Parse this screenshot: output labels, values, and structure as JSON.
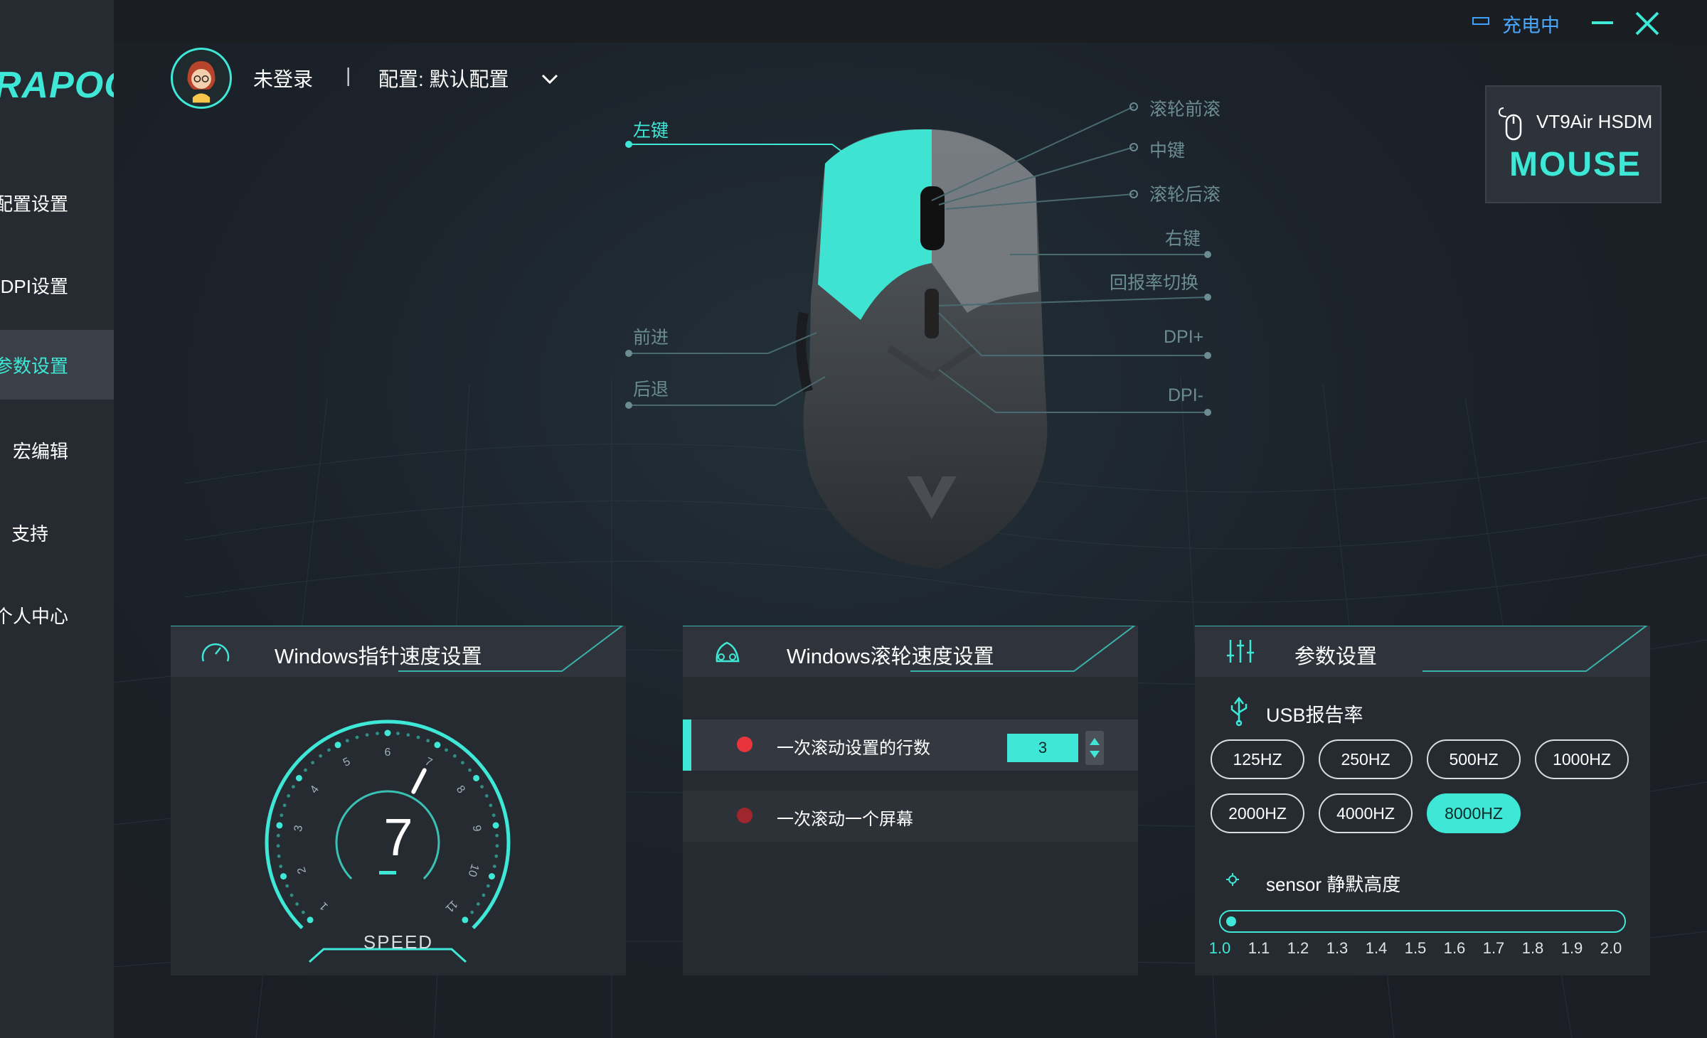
{
  "sidebar": {
    "logo": "RAPOO",
    "items": [
      {
        "label": "配置设置"
      },
      {
        "label": "DPI设置"
      },
      {
        "label": "参数设置"
      },
      {
        "label": "宏编辑"
      },
      {
        "label": "支持"
      },
      {
        "label": "个人中心"
      }
    ]
  },
  "window": {
    "charging_label": "充电中"
  },
  "header": {
    "login_status": "未登录",
    "separator": "|",
    "config_label": "配置: 默认配置"
  },
  "device": {
    "name": "VT9Air HSDM",
    "type": "MOUSE"
  },
  "mouse_buttons": {
    "left": "左键",
    "forward": "前进",
    "back": "后退",
    "wheel_forward": "滚轮前滚",
    "middle": "中键",
    "wheel_back": "滚轮后滚",
    "right": "右键",
    "report_rate_switch": "回报率切换",
    "dpi_plus": "DPI+",
    "dpi_minus": "DPI-"
  },
  "pointer_panel": {
    "title": "Windows指针速度设置",
    "speed_value": "7",
    "speed_label": "SPEED",
    "scale": [
      "1",
      "2",
      "3",
      "4",
      "5",
      "6",
      "7",
      "8",
      "9",
      "10",
      "11"
    ]
  },
  "scroll_panel": {
    "title": "Windows滚轮速度设置",
    "options": [
      {
        "label": "一次滚动设置的行数",
        "value": "3",
        "selected": true
      },
      {
        "label": "一次滚动一个屏幕",
        "selected": false
      }
    ]
  },
  "params_panel": {
    "title": "参数设置",
    "usb_label": "USB报告率",
    "rates": [
      "125HZ",
      "250HZ",
      "500HZ",
      "1000HZ",
      "2000HZ",
      "4000HZ",
      "8000HZ"
    ],
    "selected_rate": "8000HZ",
    "sensor_label": "sensor 静默高度",
    "lod_ticks": [
      "1.0",
      "1.1",
      "1.2",
      "1.3",
      "1.4",
      "1.5",
      "1.6",
      "1.7",
      "1.8",
      "1.9",
      "2.0"
    ],
    "lod_value": "1.0"
  },
  "colors": {
    "accent": "#3ee7d6",
    "bg": "#1c1f25",
    "panel": "#262a31",
    "charging": "#4aa8ff",
    "radio_active": "#e8343d",
    "radio_inactive": "#a0262d"
  }
}
